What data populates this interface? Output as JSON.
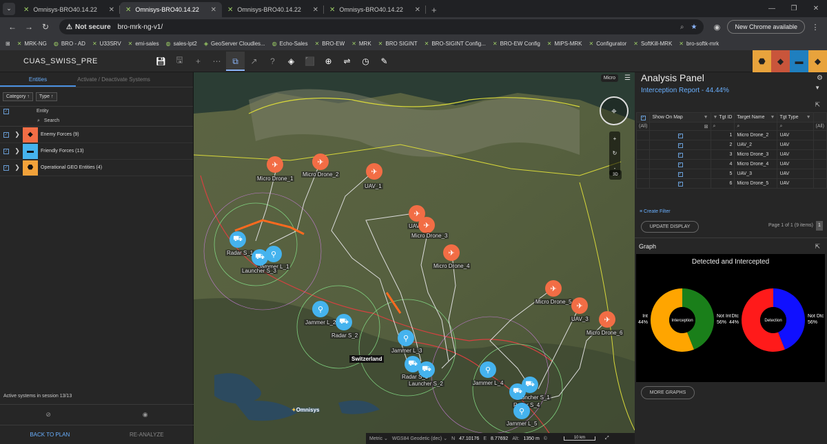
{
  "browser": {
    "tabs": [
      {
        "title": "Omnisys-BRO40.14.22",
        "close": "✕"
      },
      {
        "title": "Omnisys-BRO40.14.22",
        "close": "✕"
      },
      {
        "title": "Omnisys-BRO40.14.22",
        "close": "✕"
      },
      {
        "title": "Omnisys-BRO40.14.22",
        "close": "✕"
      }
    ],
    "new_tab": "+",
    "not_secure": "Not secure",
    "url": "bro-mrk-ng-v1/",
    "new_chrome": "New Chrome available",
    "bookmarks": [
      "MRK-NG",
      "BRO - AD",
      "U33SRV",
      "emi-sales",
      "sales-lpt2",
      "GeoServer Cloudles...",
      "Echo-Sales",
      "BRO-EW",
      "MRK",
      "BRO SIGINT",
      "BRO-SIGINT Config...",
      "BRO-EW Config",
      "MIPS-MRK",
      "Configurator",
      "SoftKill-MRK",
      "bro-softk-mrk"
    ]
  },
  "app": {
    "mission": "CUAS_SWISS_PRE",
    "system_colors": [
      "#e8a33c",
      "#c9553b",
      "#1f7fbf",
      "#e8a33c"
    ]
  },
  "left": {
    "tab_entities": "Entities",
    "tab_activate": "Activate / Deactivate Systems",
    "sort_category": "Category",
    "sort_type": "Type",
    "col_entity": "Entity",
    "search": "Search",
    "categories": [
      {
        "label": "Enemy Forces (9)",
        "color": "#f26d45",
        "icon": "◆"
      },
      {
        "label": "Friendly Forces (13)",
        "color": "#45b3ee",
        "icon": "▬"
      },
      {
        "label": "Operational GEO Entities (4)",
        "color": "#f2a23a",
        "icon": "⬣"
      }
    ],
    "status": "Active systems in session 13/13",
    "back_to_plan": "BACK TO PLAN",
    "re_analyze": "RE-ANALYZE"
  },
  "map": {
    "mode_badge": "Micro",
    "place_label": "Switzerland",
    "logo": "Omnisys",
    "zoom_in": "+",
    "zoom_out": "-",
    "rotate": "↻",
    "three_d": "3D",
    "units": [
      {
        "label": "Micro Drone_1",
        "type": "enemy"
      },
      {
        "label": "Micro Drone_2",
        "type": "enemy"
      },
      {
        "label": "UAV_1",
        "type": "enemy"
      },
      {
        "label": "UAV_2",
        "type": "enemy"
      },
      {
        "label": "Micro Drone_3",
        "type": "enemy"
      },
      {
        "label": "Micro Drone_4",
        "type": "enemy"
      },
      {
        "label": "Micro Drone_5",
        "type": "enemy"
      },
      {
        "label": "UAV_3",
        "type": "enemy"
      },
      {
        "label": "Micro Drone_6",
        "type": "enemy"
      },
      {
        "label": "Radar S_1",
        "type": "friend"
      },
      {
        "label": "Jammer L_1",
        "type": "friend"
      },
      {
        "label": "Launcher S_3",
        "type": "friend"
      },
      {
        "label": "Jammer L_2",
        "type": "friend"
      },
      {
        "label": "Radar S_2",
        "type": "friend"
      },
      {
        "label": "Jammer L_3",
        "type": "friend"
      },
      {
        "label": "Radar S_3",
        "type": "friend"
      },
      {
        "label": "Launcher S_2",
        "type": "friend"
      },
      {
        "label": "Jammer L_4",
        "type": "friend"
      },
      {
        "label": "Launcher S_1",
        "type": "friend"
      },
      {
        "label": "Radar S_4",
        "type": "friend"
      },
      {
        "label": "Jammer L_5",
        "type": "friend"
      }
    ],
    "status": {
      "units": "Metric",
      "datum": "WGS84 Geodetic (dec)",
      "n_label": "N",
      "n_value": "47.10176",
      "e_label": "E",
      "e_value": "8.77692",
      "alt_label": "Alt:",
      "alt_value": "1350 m",
      "scale": "10 km"
    }
  },
  "analysis": {
    "title": "Analysis Panel",
    "subtitle": "Interception Report - 44.44%",
    "columns": [
      "Show On Map",
      "Tgt ID",
      "Target Name",
      "Tgt Type"
    ],
    "filter_all": "(All)",
    "rows": [
      {
        "id": "1",
        "name": "Micro Drone_2",
        "type": "UAV"
      },
      {
        "id": "2",
        "name": "UAV_2",
        "type": "UAV"
      },
      {
        "id": "3",
        "name": "Micro Drone_3",
        "type": "UAV"
      },
      {
        "id": "4",
        "name": "Micro Drone_4",
        "type": "UAV"
      },
      {
        "id": "5",
        "name": "UAV_3",
        "type": "UAV"
      },
      {
        "id": "6",
        "name": "Micro Drone_5",
        "type": "UAV"
      }
    ],
    "create_filter": "Create Filter",
    "update_display": "UPDATE DISPLAY",
    "pager": "Page 1 of 1 (9 items)",
    "page": "1",
    "graph_title": "Graph",
    "more_graphs": "MORE GRAPHS"
  },
  "chart_data": {
    "type": "pie",
    "title": "Detected and Intercepted",
    "charts": [
      {
        "center_label": "Interception",
        "slices": [
          {
            "name": "Int",
            "value": 44,
            "label": "44%",
            "color": "#1a7f1a"
          },
          {
            "name": "Not Int",
            "value": 56,
            "label": "56%",
            "color": "#ffa500"
          }
        ]
      },
      {
        "center_label": "Detection",
        "slices": [
          {
            "name": "Dtc",
            "value": 44,
            "label": "44%",
            "color": "#1010ff"
          },
          {
            "name": "Not Dtc",
            "value": 56,
            "label": "56%",
            "color": "#ff1a1a"
          }
        ]
      }
    ]
  }
}
